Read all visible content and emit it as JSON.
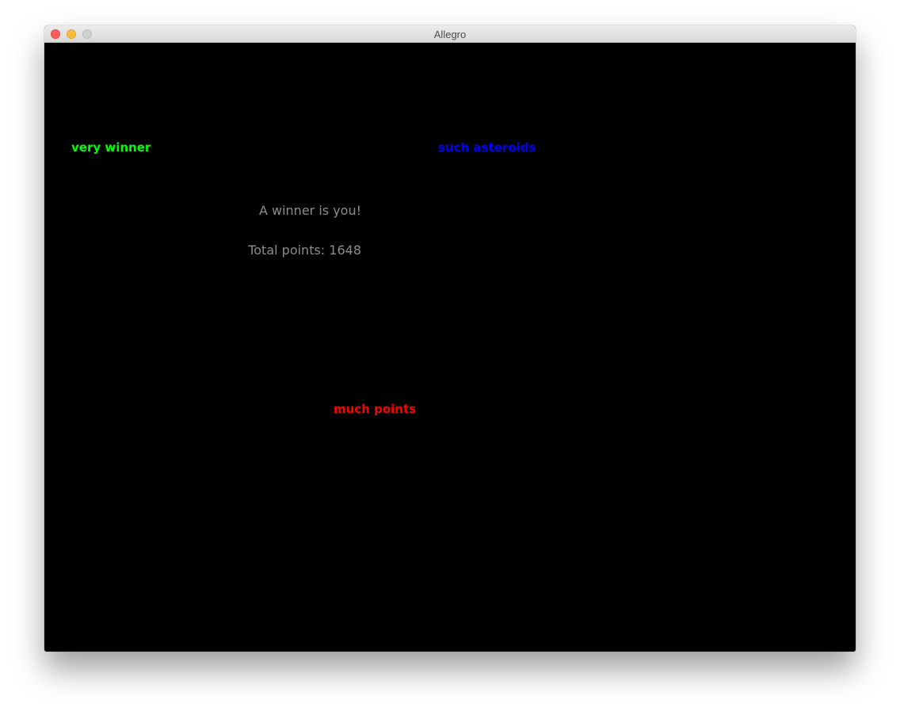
{
  "window": {
    "title": "Allegro"
  },
  "game": {
    "doge_green": "very winner",
    "doge_blue": "such asteroids",
    "doge_red": "much points",
    "winner_message": "A winner is you!",
    "total_points_text": "Total points: 1648",
    "total_points": 1648
  },
  "colors": {
    "background": "#000000",
    "green": "#00ff00",
    "blue": "#0000ff",
    "red": "#ff0000",
    "gray": "#8c8c8c"
  }
}
